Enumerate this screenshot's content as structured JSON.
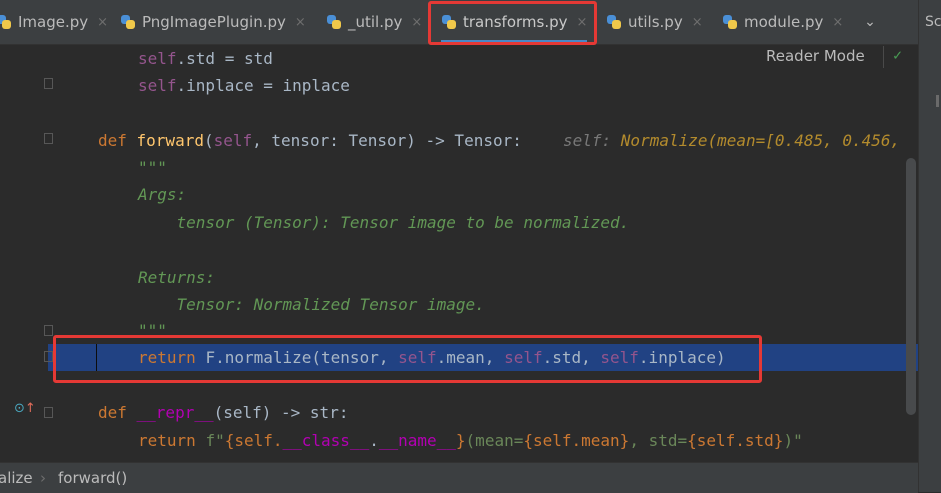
{
  "tabs": [
    {
      "label": "Image.py",
      "active": false
    },
    {
      "label": "PngImagePlugin.py",
      "active": false
    },
    {
      "label": "_util.py",
      "active": false
    },
    {
      "label": "transforms.py",
      "active": true
    },
    {
      "label": "utils.py",
      "active": false
    },
    {
      "label": "module.py",
      "active": false
    }
  ],
  "tab_close_glyph": "×",
  "tab_overflow_glyph": "⌄",
  "right_panel_label": "Sc",
  "reader_mode_label": "Reader Mode",
  "reader_check_glyph": "✓",
  "code": {
    "l1_self": "self",
    "l1_rest": ".std = std",
    "l2_self": "self",
    "l2_rest": ".inplace = inplace",
    "l4_def": "def ",
    "l4_fn": "forward",
    "l4_open": "(",
    "l4_self": "self",
    "l4_params": ", tensor: Tensor) -> Tensor:",
    "l4_hint_key": "self: ",
    "l4_hint_val": "Normalize(mean=[0.485, 0.456,",
    "l5": "\"\"\"",
    "l6": "Args:",
    "l7": "    tensor (Tensor): Tensor image to be normalized.",
    "l9": "Returns:",
    "l10": "    Tensor: Normalized Tensor image.",
    "l11": "\"\"\"",
    "l12_kw": "return ",
    "l12_a": "F.normalize(tensor, ",
    "l12_self1": "self",
    "l12_b": ".mean, ",
    "l12_self2": "self",
    "l12_c": ".std, ",
    "l12_self3": "self",
    "l12_d": ".inplace)",
    "l14_def": "def ",
    "l14_fn": "__repr__",
    "l14_rest": "(self) -> str:",
    "l15_kw": "return ",
    "l15_f": "f\"",
    "l15_b1": "{self.",
    "l15_class": "__class__",
    "l15_dot": ".",
    "l15_name": "__name__",
    "l15_b2": "}",
    "l15_s1": "(mean=",
    "l15_b3": "{self.mean}",
    "l15_s2": ", std=",
    "l15_b4": "{self.std}",
    "l15_s3": ")\""
  },
  "breadcrumb": {
    "items": [
      "alize",
      "forward()"
    ],
    "separator": "›"
  },
  "gutter_override_glyph": "⊙↑",
  "colors": {
    "accent_tab_underline": "#4a88c7",
    "selection": "#214283",
    "annotation_red": "#e53935",
    "keyword": "#cc7832",
    "function": "#ffc66d",
    "self": "#94558d",
    "docstring": "#629755"
  }
}
